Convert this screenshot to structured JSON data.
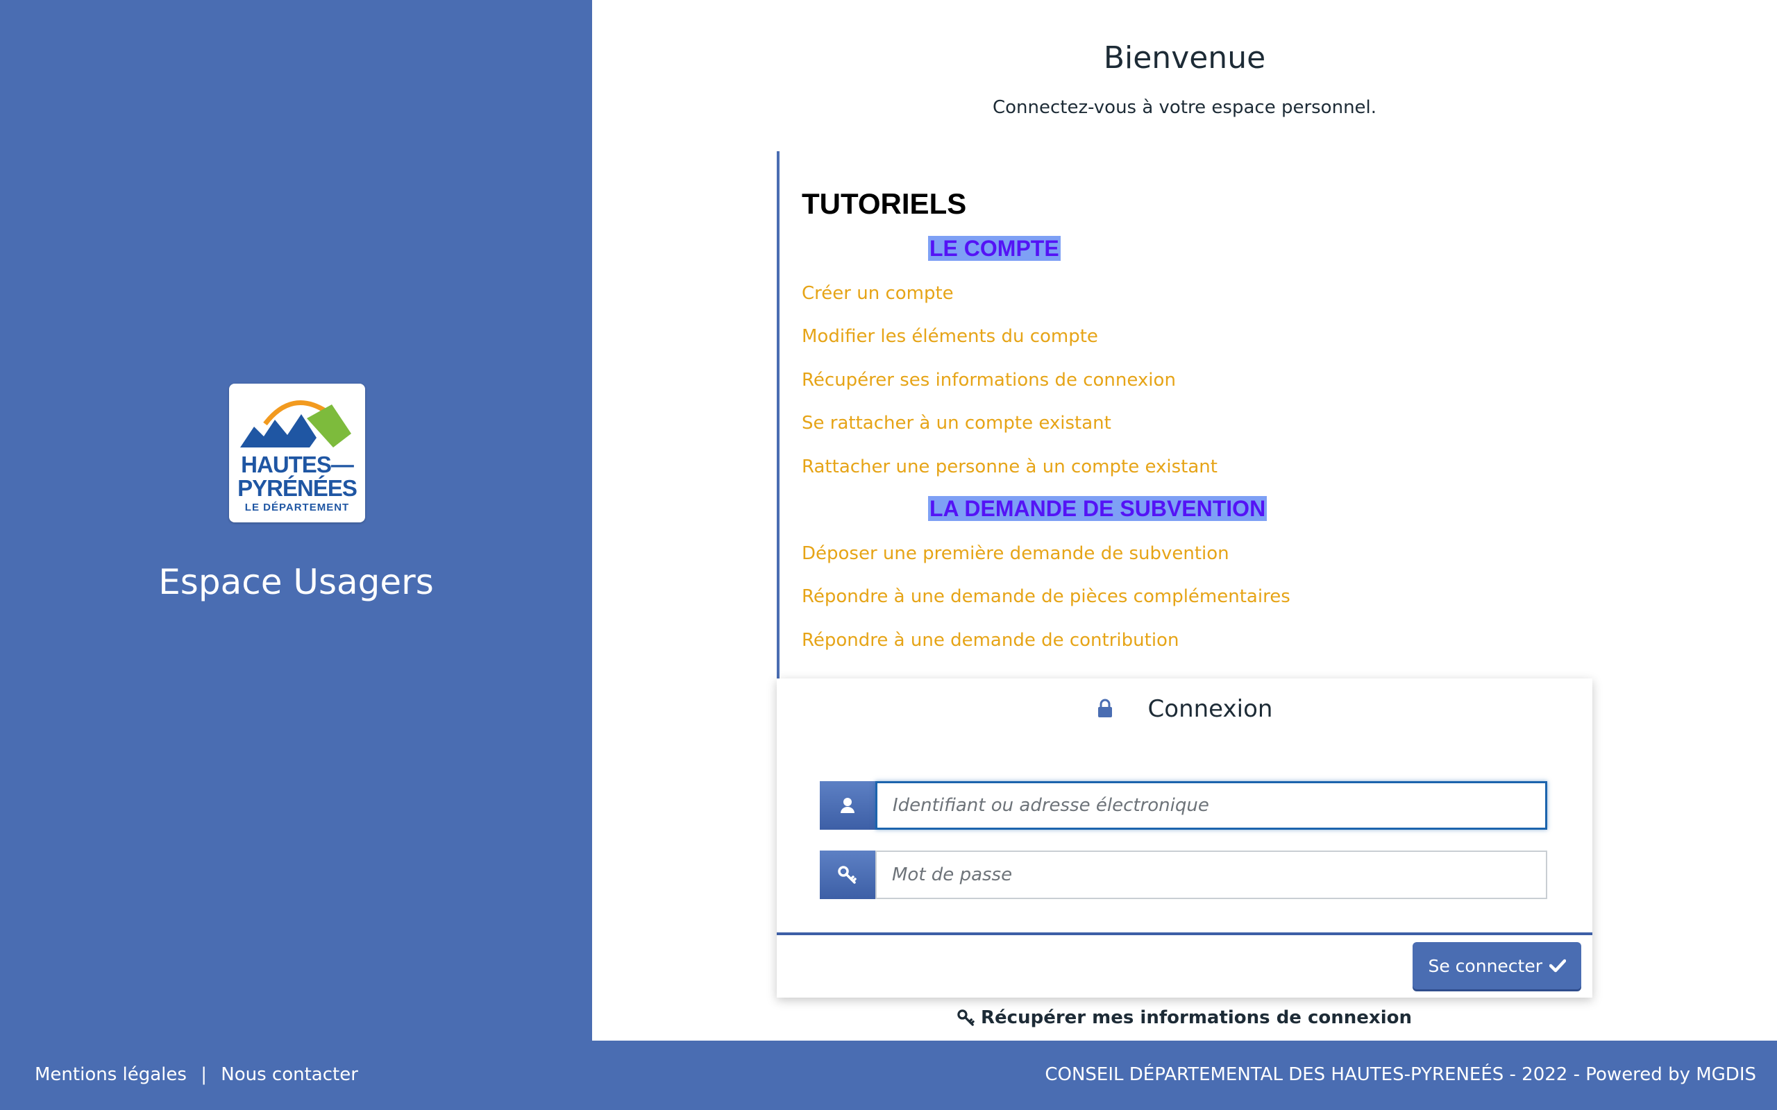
{
  "app": {
    "name": "Espace Usagers",
    "logo": {
      "line1": "HAUTES—",
      "line2": "PYRÉNÉES",
      "line3": "LE DÉPARTEMENT"
    }
  },
  "welcome": {
    "title": "Bienvenue",
    "subtitle": "Connectez-vous à votre espace personnel."
  },
  "tutorials": {
    "title": "TUTORIELS",
    "sections": [
      {
        "heading": "LE COMPTE",
        "links": [
          "Créer un compte",
          "Modifier les éléments du compte",
          "Récupérer ses informations de connexion",
          "Se rattacher à un compte existant",
          "Rattacher une personne à un compte existant"
        ]
      },
      {
        "heading": "LA DEMANDE DE SUBVENTION",
        "links": [
          "Déposer une première demande de subvention",
          "Répondre à une demande de pièces complémentaires",
          "Répondre à une demande de contribution"
        ]
      }
    ]
  },
  "login": {
    "title": "Connexion",
    "username_placeholder": "Identifiant ou adresse électronique",
    "password_placeholder": "Mot de passe",
    "submit_label": "Se connecter",
    "recover_label": "Récupérer mes informations de connexion"
  },
  "footer": {
    "legal": "Mentions légales",
    "separator": "|",
    "contact": "Nous contacter",
    "copyright": "CONSEIL DÉPARTEMENTAL DES HAUTES-PYRENEÉS - 2022 - Powered by MGDIS"
  },
  "colors": {
    "brand_blue": "#4a6db2",
    "link_orange": "#e6a417",
    "section_purple": "#5413f5",
    "section_highlight": "#7ea0f5"
  },
  "icons": {
    "lock": "lock-icon",
    "user": "user-icon",
    "key": "key-icon",
    "check": "check-icon"
  }
}
